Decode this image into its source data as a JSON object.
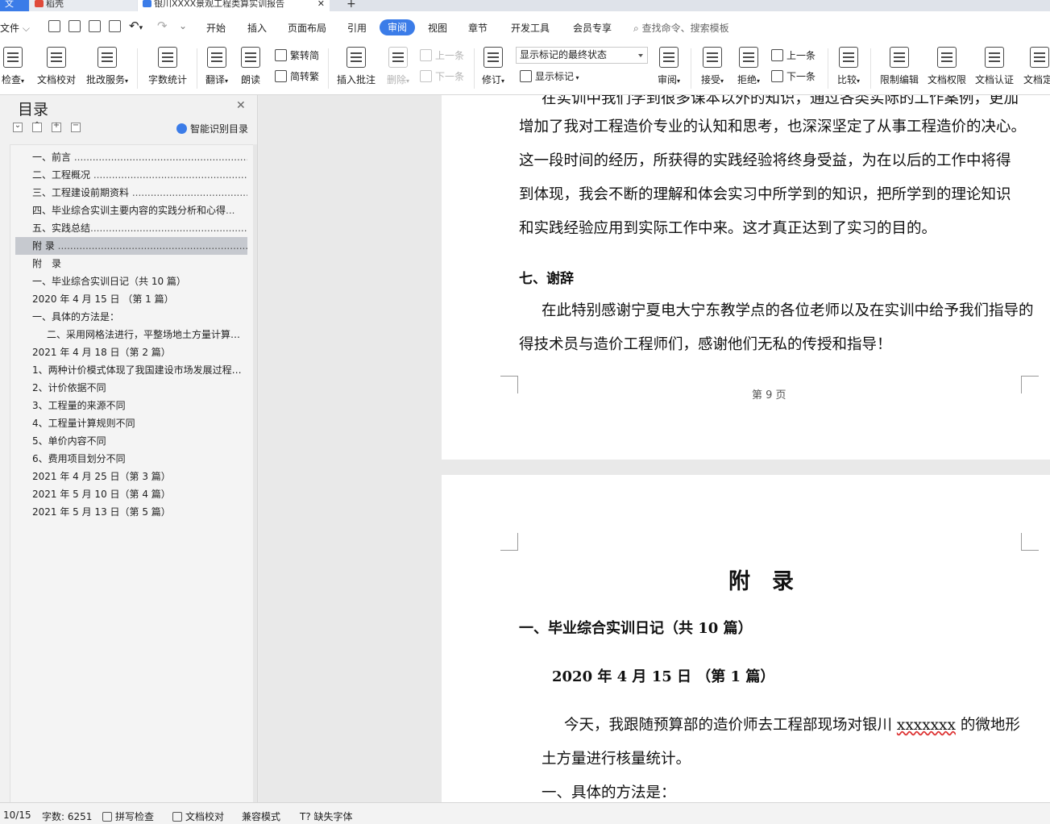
{
  "tabs": {
    "items": [
      {
        "label": "文"
      },
      {
        "label": "稻壳"
      },
      {
        "label": "银川XXXX景观工程类算实训报告"
      }
    ],
    "add_label": "+",
    "close_label": "✕"
  },
  "menu": {
    "file": "文件",
    "items": [
      "开始",
      "插入",
      "页面布局",
      "引用",
      "审阅",
      "视图",
      "章节",
      "开发工具",
      "会员专享"
    ],
    "active": "审阅",
    "search_placeholder": "查找命令、搜索模板"
  },
  "ribbon": {
    "spell_check": "检查",
    "doc_proof": "文档校对",
    "revise_service": "批改服务",
    "word_count": "字数统计",
    "translate": "翻译",
    "read_aloud": "朗读",
    "trad_to_simp": "繁转简",
    "simp_to_trad": "简转繁",
    "insert_comment": "插入批注",
    "delete": "删除",
    "prev_comment": "上一条",
    "next_comment": "下一条",
    "track_changes": "修订",
    "markup_mode": "显示标记的最终状态",
    "show_markup": "显示标记",
    "review": "审阅",
    "accept": "接受",
    "reject": "拒绝",
    "prev_change": "上一条",
    "next_change": "下一条",
    "compare": "比较",
    "restrict_edit": "限制编辑",
    "doc_permission": "文档权限",
    "doc_certify": "文档认证",
    "doc_final": "文档定"
  },
  "nav": {
    "title": "目录",
    "smart_toc": "智能识别目录",
    "items": [
      {
        "text": "一、前言 ",
        "selected": false,
        "indent": false
      },
      {
        "text": "二、工程概况 ",
        "selected": false,
        "indent": false
      },
      {
        "text": "三、工程建设前期资料 ",
        "selected": false,
        "indent": false
      },
      {
        "text": "四、毕业综合实训主要内容的实践分析和心得",
        "selected": false,
        "indent": false
      },
      {
        "text": "五、实践总结",
        "selected": false,
        "indent": false
      },
      {
        "text": "附 录 ",
        "selected": true,
        "indent": false
      },
      {
        "text": "附　录",
        "selected": false,
        "indent": false
      },
      {
        "text": "一、毕业综合实训日记（共 10 篇）",
        "selected": false,
        "indent": false
      },
      {
        "text": "2020 年 4 月 15 日 （第 1 篇）",
        "selected": false,
        "indent": false
      },
      {
        "text": "一、具体的方法是：",
        "selected": false,
        "indent": false
      },
      {
        "text": "二、采用网格法进行，平整场地土方量计算…",
        "selected": false,
        "indent": true
      },
      {
        "text": "2021 年 4 月 18 日（第 2 篇）",
        "selected": false,
        "indent": false
      },
      {
        "text": "1、两种计价模式体现了我国建设市场发展过程…",
        "selected": false,
        "indent": false
      },
      {
        "text": "2、计价依据不同",
        "selected": false,
        "indent": false
      },
      {
        "text": "3、工程量的来源不同",
        "selected": false,
        "indent": false
      },
      {
        "text": "4、工程量计算规则不同",
        "selected": false,
        "indent": false
      },
      {
        "text": "5、单价内容不同",
        "selected": false,
        "indent": false
      },
      {
        "text": "6、费用项目划分不同",
        "selected": false,
        "indent": false
      },
      {
        "text": "2021 年 4 月 25 日（第 3 篇）",
        "selected": false,
        "indent": false
      },
      {
        "text": "2021 年 5 月 10 日（第 4 篇）",
        "selected": false,
        "indent": false
      },
      {
        "text": "2021 年 5 月 13 日（第 5 篇）",
        "selected": false,
        "indent": false
      }
    ]
  },
  "document": {
    "page9": {
      "lines": [
        "在实训中我们学到很多课本以外的知识，通过各类实际的工作案例，更加",
        "增加了我对工程造价专业的认知和思考，也深深坚定了从事工程造价的决心。",
        "这一段时间的经历，所获得的实践经验将终身受益，为在以后的工作中将得",
        "到体现，我会不断的理解和体会实习中所学到的知识，把所学到的理论知识",
        "和实践经验应用到实际工作中来。这才真正达到了实习的目的。"
      ],
      "heading": "七、谢辞",
      "thanks_lines": [
        "在此特别感谢宁夏电大宁东教学点的各位老师以及在实训中给予我们指导的",
        "得技术员与造价工程师们，感谢他们无私的传授和指导！"
      ],
      "page_number": "第 9 页"
    },
    "page10": {
      "title": "附　录",
      "section": "一、毕业综合实训日记（共 10 篇）",
      "date_heading": "2020 年 4 月 15 日 （第 1 篇）",
      "para_start": "今天，我跟随预算部的造价师去工程部现场对银川 ",
      "para_underlined": "xxxxxxx",
      "para_end": " 的微地形",
      "para_line2": "土方量进行核量统计。",
      "list_item": "一、具体的方法是："
    }
  },
  "status": {
    "page": "10/15",
    "word_count": "字数: 6251",
    "spell_check": "拼写检查",
    "doc_proof": "文档校对",
    "compat_mode": "兼容模式",
    "missing_font": "缺失字体"
  }
}
